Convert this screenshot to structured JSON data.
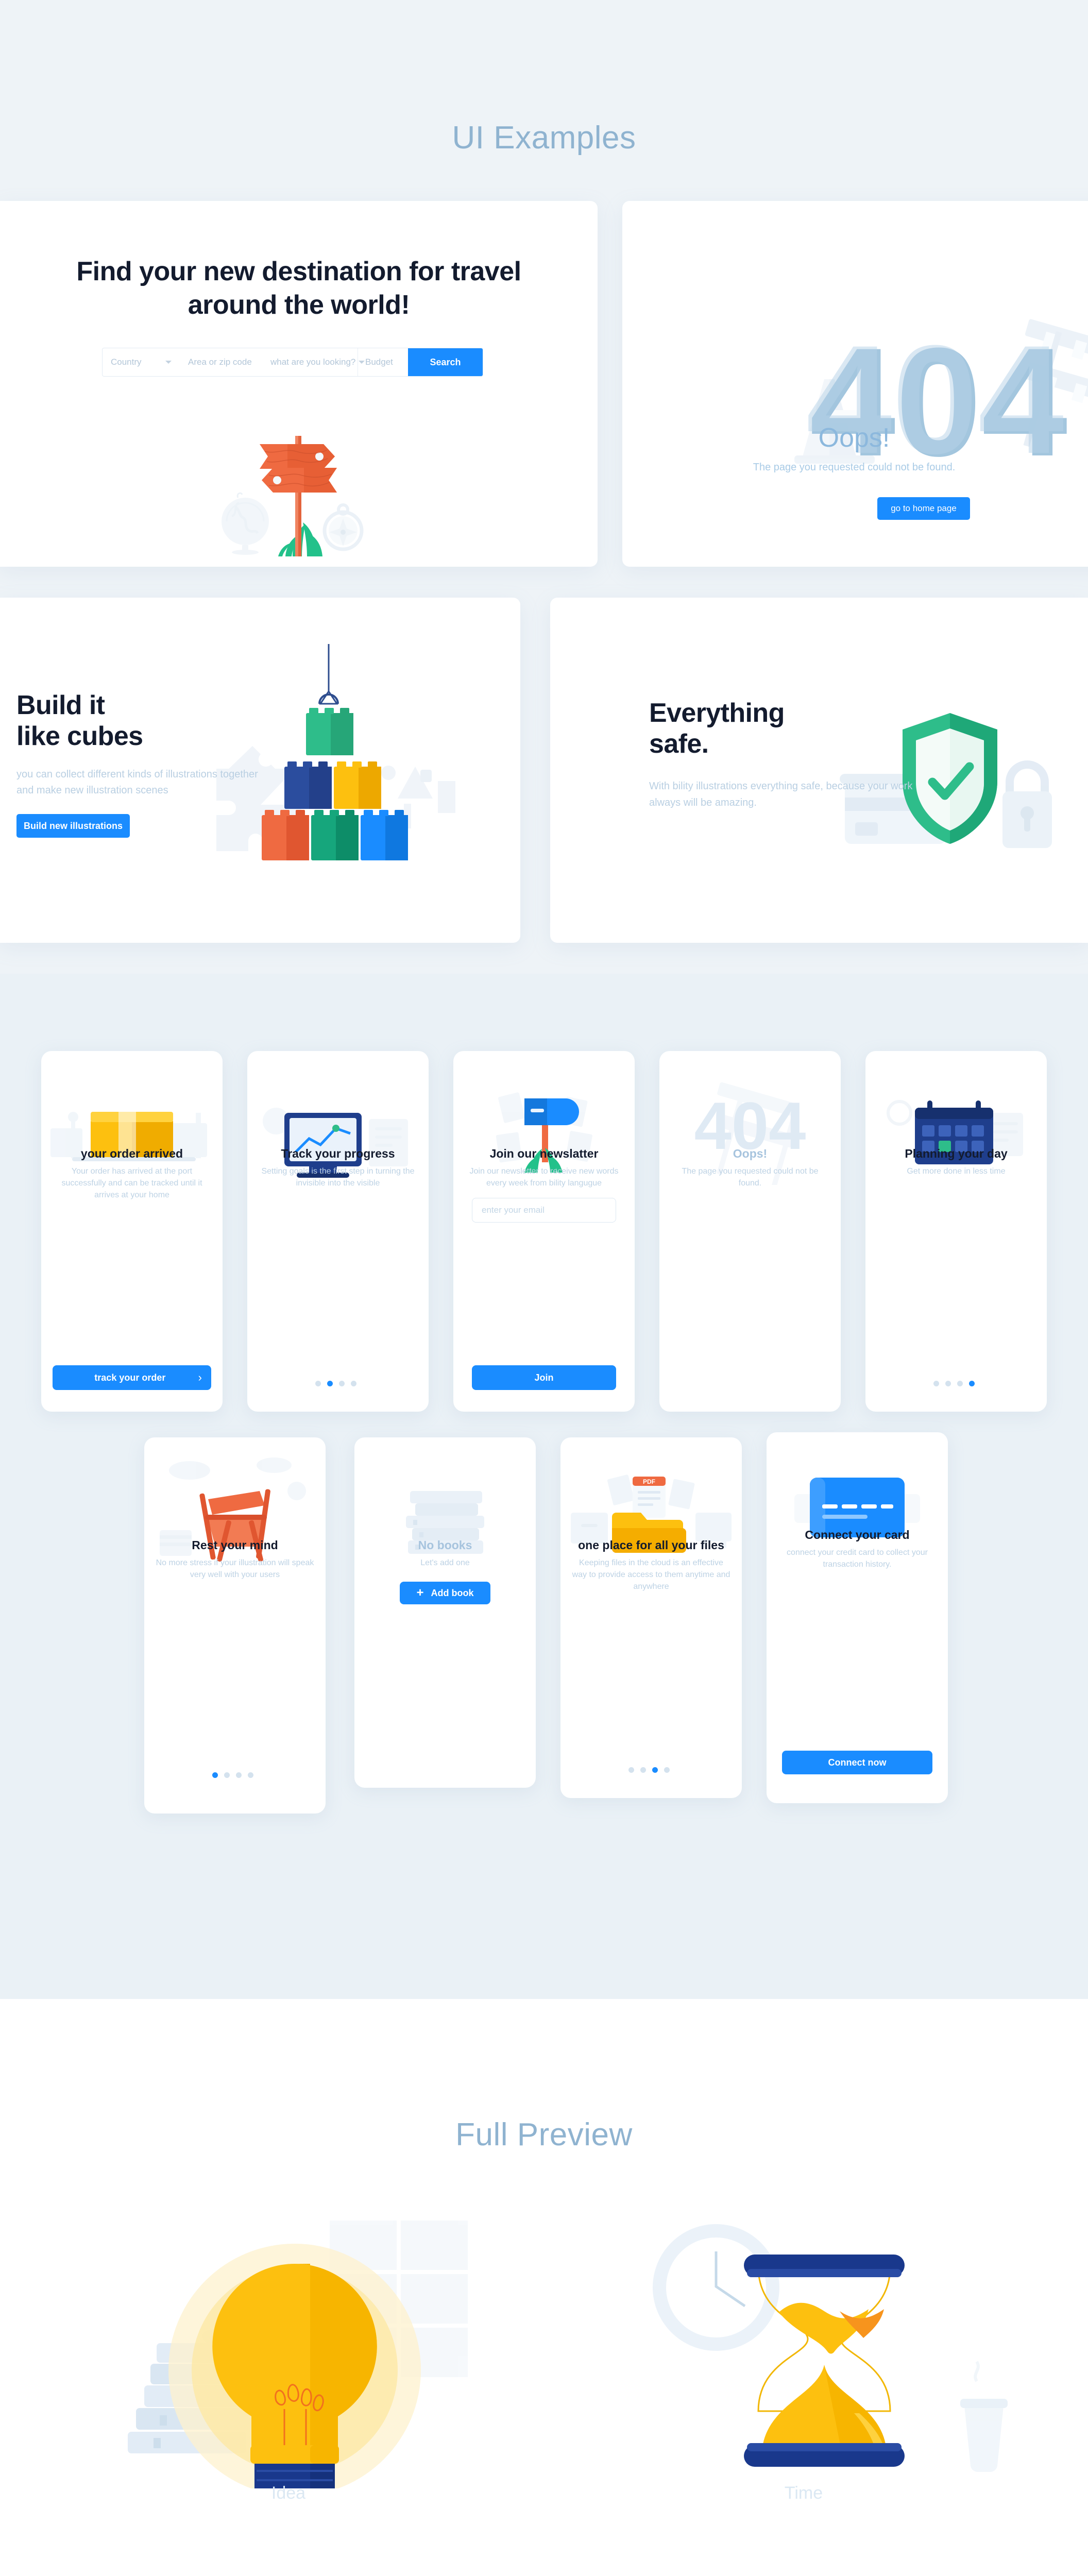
{
  "sections": {
    "ui_examples_title": "UI Examples",
    "full_preview_title": "Full Preview"
  },
  "colors": {
    "accent_blue": "#1a8cff",
    "dark_navy": "#131b2e",
    "muted_blue": "#b9cfe2",
    "title_blue": "#8fb3d0",
    "page_bg": "#eef3f7",
    "mobile_band_bg": "#eaf1f6",
    "orange": "#ef6a41",
    "green": "#2ebd8a",
    "yellow": "#fdc00f"
  },
  "travel_card": {
    "heading": "Find your new destination for travel around the world!",
    "search": {
      "country_label": "Country",
      "area_placeholder": "Area or zip code",
      "looking_label": "what are you looking?",
      "budget_placeholder": "Budget",
      "search_button": "Search"
    },
    "illustration": "signpost-globe-compass-illustration"
  },
  "error_card": {
    "code": "404",
    "title": "Oops!",
    "subtitle": "The page you requested could not be found.",
    "button": "go to home page",
    "illustration": "traffic-cone-barrier-illustration"
  },
  "cubes_card": {
    "heading_line1": "Build it",
    "heading_line2": "like cubes",
    "subtitle": "you can collect different kinds of illustrations together and make new illustration scenes",
    "button": "Build new illustrations",
    "illustration": "lego-blocks-crane-illustration"
  },
  "safe_card": {
    "heading_line1": "Everything",
    "heading_line2": "safe.",
    "subtitle": "With bility illustrations everything safe, because your work always will be amazing.",
    "illustration": "shield-check-credit-card-lock-illustration"
  },
  "phones_row1": [
    {
      "illustration": "package-delivery-illustration",
      "title": "your order arrived",
      "subtitle": "Your order has arrived at the port successfully and can be tracked until it arrives at your home",
      "button": "track your order",
      "button_arrow": "›",
      "dots": null
    },
    {
      "illustration": "desktop-chart-progress-illustration",
      "title": "Track your progress",
      "subtitle": "Setting goals is the first step in turning the invisible into the visible",
      "button": null,
      "dots": {
        "count": 4,
        "active": 1
      }
    },
    {
      "illustration": "mailbox-newsletter-illustration",
      "title": "Join our newslatter",
      "subtitle": "Join our newsletter to receive new words every week from bility langugue",
      "input_placeholder": "enter your email",
      "button": "Join",
      "dots": null
    },
    {
      "illustration": "barrier-404-illustration",
      "title": "Oops!",
      "title_muted": true,
      "subtitle": "The page you requested could not be found.",
      "button": null,
      "dots": null
    },
    {
      "illustration": "calendar-planner-illustration",
      "title": "Planning your day",
      "subtitle": "Get more done in less time",
      "button": null,
      "dots": {
        "count": 4,
        "active": 3
      }
    }
  ],
  "phones_row2": [
    {
      "illustration": "deck-chair-rest-illustration",
      "title": "Rest your mind",
      "subtitle": "No more stress if your illustration will speak very well with your users",
      "button": null,
      "dots": {
        "count": 4,
        "active": 0
      }
    },
    {
      "illustration": "stacked-books-illustration",
      "title": "No books",
      "title_muted": true,
      "subtitle": "Let's add one",
      "button": "Add book",
      "button_icon": "plus-icon",
      "dots": null
    },
    {
      "illustration": "folders-files-cloud-illustration",
      "title": "one place for all your files",
      "subtitle": "Keeping files in the cloud is an effective way to provide access to them anytime and anywhere",
      "button": null,
      "dots": {
        "count": 4,
        "active": 2
      }
    },
    {
      "illustration": "credit-card-illustration",
      "title": "Connect your card",
      "subtitle": "connect your credit card to collect your transaction history.",
      "button": "Connect now",
      "dots": null
    }
  ],
  "full_preview": [
    {
      "illustration": "lightbulb-books-illustration",
      "label": "Idea"
    },
    {
      "illustration": "hourglass-clock-coffee-illustration",
      "label": "Time"
    }
  ]
}
